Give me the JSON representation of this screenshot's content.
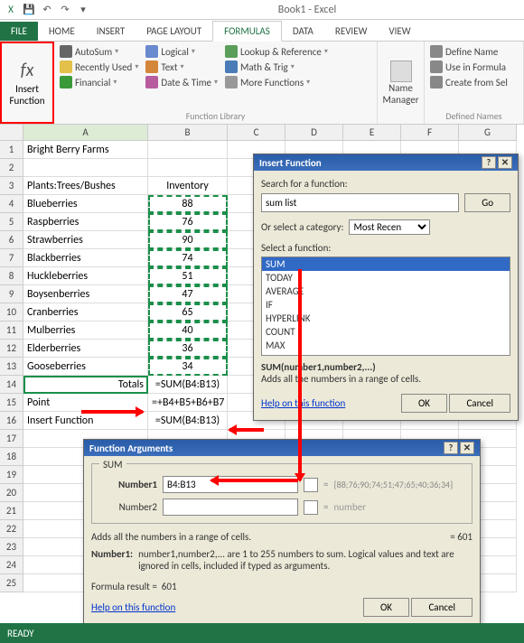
{
  "window": {
    "title": "Book1 - Excel"
  },
  "qat": {
    "save": "💾",
    "undo": "↶",
    "redo": "↷",
    "more": "▾"
  },
  "tabs": [
    "FILE",
    "HOME",
    "INSERT",
    "PAGE LAYOUT",
    "FORMULAS",
    "DATA",
    "REVIEW",
    "VIEW"
  ],
  "ribbon": {
    "insert_function": {
      "label1": "Insert",
      "label2": "Function"
    },
    "library": {
      "items_col1": [
        "AutoSum",
        "Recently Used",
        "Financial"
      ],
      "items_col2": [
        "Logical",
        "Text",
        "Date & Time"
      ],
      "items_col3": [
        "Lookup & Reference",
        "Math & Trig",
        "More Functions"
      ],
      "label": "Function Library"
    },
    "name_mgr": {
      "label": "Name",
      "label2": "Manager"
    },
    "defined": {
      "items": [
        "Define Name",
        "Use in Formula",
        "Create from Sel"
      ],
      "label": "Defined Names"
    }
  },
  "columns": [
    "A",
    "B",
    "C",
    "D",
    "E",
    "F",
    "G"
  ],
  "rows": [
    {
      "n": 1,
      "A": "Bright Berry Farms",
      "B": ""
    },
    {
      "n": 2,
      "A": "",
      "B": ""
    },
    {
      "n": 3,
      "A": "Plants:Trees/Bushes",
      "B": "Inventory"
    },
    {
      "n": 4,
      "A": "Blueberries",
      "B": "88"
    },
    {
      "n": 5,
      "A": "Raspberries",
      "B": "76"
    },
    {
      "n": 6,
      "A": "Strawberries",
      "B": "90"
    },
    {
      "n": 7,
      "A": "Blackberries",
      "B": "74"
    },
    {
      "n": 8,
      "A": "Huckleberries",
      "B": "51"
    },
    {
      "n": 9,
      "A": "Boysenberries",
      "B": "47"
    },
    {
      "n": 10,
      "A": "Cranberries",
      "B": "65"
    },
    {
      "n": 11,
      "A": "Mulberries",
      "B": "40"
    },
    {
      "n": 12,
      "A": "Elderberries",
      "B": "36"
    },
    {
      "n": 13,
      "A": "Gooseberries",
      "B": "34"
    },
    {
      "n": 14,
      "A": "Totals",
      "B": "=SUM(B4:B13)"
    },
    {
      "n": 15,
      "A": "Point",
      "B": "=+B4+B5+B6+B7"
    },
    {
      "n": 16,
      "A": "Insert Function",
      "B": "=SUM(B4:B13)"
    },
    {
      "n": 17,
      "A": "",
      "B": ""
    },
    {
      "n": 18,
      "A": "",
      "B": ""
    },
    {
      "n": 19,
      "A": "",
      "B": ""
    },
    {
      "n": 20,
      "A": "",
      "B": ""
    },
    {
      "n": 21,
      "A": "",
      "B": ""
    },
    {
      "n": 22,
      "A": "",
      "B": ""
    },
    {
      "n": 23,
      "A": "",
      "B": ""
    },
    {
      "n": 24,
      "A": "",
      "B": ""
    },
    {
      "n": 25,
      "A": "",
      "B": ""
    }
  ],
  "insert_dlg": {
    "title": "Insert Function",
    "search_label": "Search for a function:",
    "search_value": "sum list",
    "go": "Go",
    "category_label": "Or select a category:",
    "category_value": "Most Recen",
    "select_label": "Select a function:",
    "functions": [
      "SUM",
      "TODAY",
      "AVERAGE",
      "IF",
      "HYPERLINK",
      "COUNT",
      "MAX"
    ],
    "signature": "SUM(number1,number2,...)",
    "desc": "Adds all the numbers in a range of cells.",
    "help": "Help on this function",
    "ok": "OK",
    "cancel": "Cancel"
  },
  "args_dlg": {
    "title": "Function Arguments",
    "fn": "SUM",
    "number1_label": "Number1",
    "number1_value": "B4:B13",
    "number1_eval": "{88;76;90;74;51;47;65;40;36;34}",
    "number2_label": "Number2",
    "number2_value": "",
    "number2_hint": "number",
    "desc": "Adds all the numbers in a range of cells.",
    "result_inline": "= 601",
    "arg_help_label": "Number1:",
    "arg_help": "number1,number2,... are 1 to 255 numbers to sum. Logical values and text are ignored in cells, included if typed as arguments.",
    "formula_result_label": "Formula result =",
    "formula_result": "601",
    "help": "Help on this function",
    "ok": "OK",
    "cancel": "Cancel"
  },
  "status": "READY",
  "chart_data": {
    "type": "table",
    "title": "Bright Berry Farms Inventory",
    "categories": [
      "Blueberries",
      "Raspberries",
      "Strawberries",
      "Blackberries",
      "Huckleberries",
      "Boysenberries",
      "Cranberries",
      "Mulberries",
      "Elderberries",
      "Gooseberries"
    ],
    "values": [
      88,
      76,
      90,
      74,
      51,
      47,
      65,
      40,
      36,
      34
    ],
    "sum": 601
  }
}
